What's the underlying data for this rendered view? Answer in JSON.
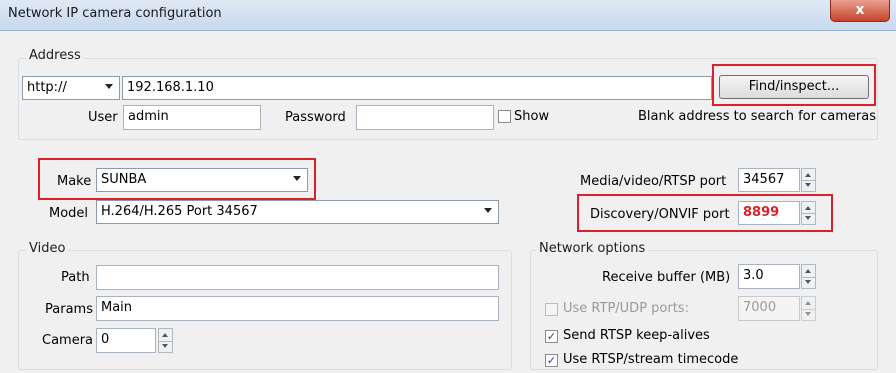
{
  "window": {
    "title": "Network IP camera configuration",
    "close_glyph": "x"
  },
  "address": {
    "group_label": "Address",
    "protocol": "http://",
    "address_value": "192.168.1.10",
    "find_button": "Find/inspect...",
    "user_label": "User",
    "user_value": "admin",
    "password_label": "Password",
    "password_value": "",
    "show_label": "Show",
    "hint": "Blank address to search for cameras"
  },
  "camera": {
    "make_label": "Make",
    "make_value": "SUNBA",
    "model_label": "Model",
    "model_value": "H.264/H.265 Port 34567",
    "media_port_label": "Media/video/RTSP port",
    "media_port_value": "34567",
    "onvif_port_label": "Discovery/ONVIF port",
    "onvif_port_value": "8899"
  },
  "video": {
    "group_label": "Video",
    "path_label": "Path",
    "path_value": "",
    "params_label": "Params",
    "params_value": "Main",
    "camera_label": "Camera",
    "camera_value": "0"
  },
  "network": {
    "group_label": "Network options",
    "buffer_label": "Receive buffer (MB)",
    "buffer_value": "3.0",
    "rtp_label": "Use RTP/UDP ports:",
    "rtp_value": "7000",
    "keepalive_label": "Send RTSP keep-alives",
    "timecode_label": "Use RTSP/stream timecode"
  },
  "colors": {
    "highlight": "#d9212c",
    "onvif_text": "#d9212c"
  }
}
